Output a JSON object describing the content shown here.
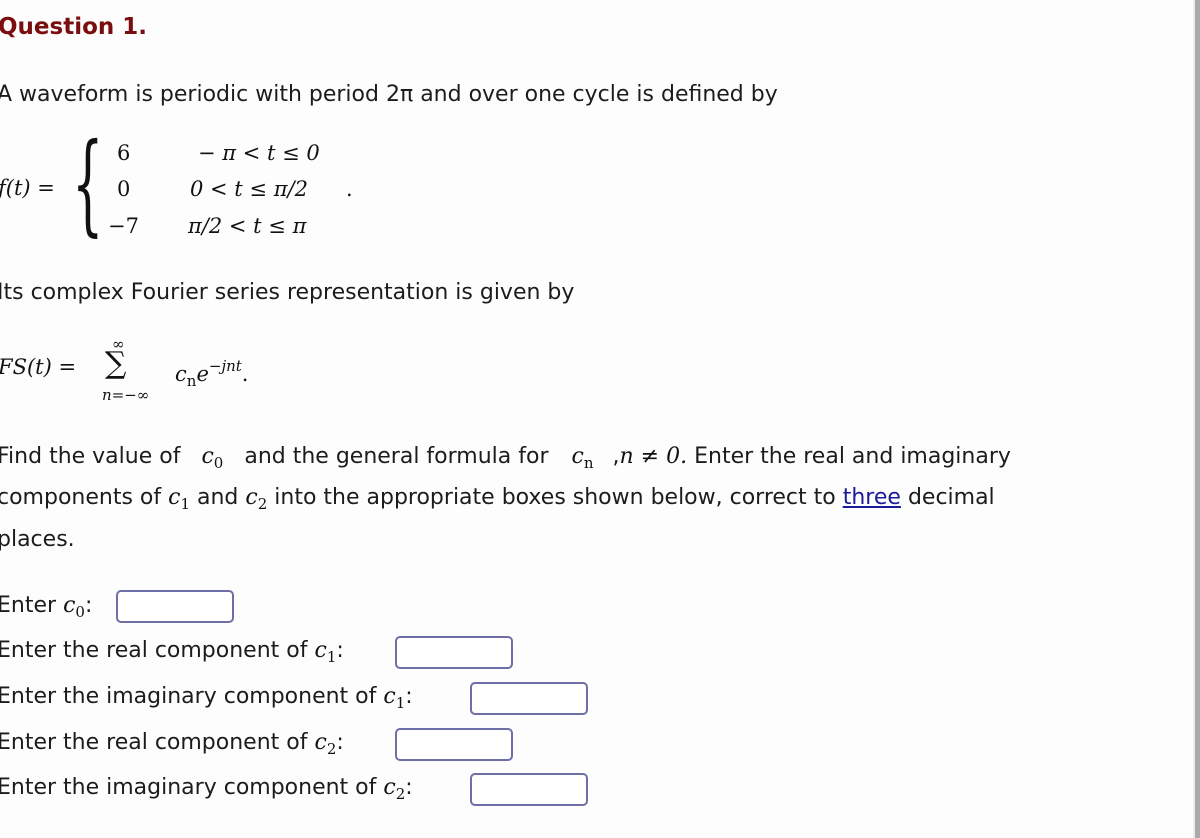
{
  "question": {
    "title": "Question 1.",
    "intro": "A waveform is periodic with period 2π and over one cycle is defined by",
    "function_lhs": "f(t) =",
    "piecewise": [
      {
        "value": "6",
        "condition": "− π < t ≤ 0"
      },
      {
        "value": "0",
        "condition": "0 < t ≤ π/2"
      },
      {
        "value": "−7",
        "condition": "π/2 < t ≤ π"
      }
    ],
    "piecewise_end": ".",
    "fourier_intro": "Its complex Fourier series representation is given by",
    "fourier": {
      "lhs": "FS(t) =",
      "sigma": "∑",
      "upper_limit": "∞",
      "lower_limit": "n=−∞",
      "term_base": "c",
      "term_sub": "n",
      "term_e": "e",
      "term_exp": "−jnt",
      "end": "."
    },
    "instructions": {
      "part1": "Find the value of",
      "c0_base": "c",
      "c0_sub": "0",
      "part2": "and the general formula for",
      "cn_base": "c",
      "cn_sub": "n",
      "part3": ",",
      "n_condition": "n ≠ 0.",
      "part4": "Enter the real and imaginary",
      "line2_a": "components of",
      "c1_base": "c",
      "c1_sub": "1",
      "line2_b": "and",
      "c2_base": "c",
      "c2_sub": "2",
      "line2_c": "into the appropriate boxes shown below, correct to",
      "link_text": "three",
      "line2_d": "decimal",
      "line3": "places."
    }
  },
  "answers": [
    {
      "label_pre": "Enter",
      "var": "c",
      "sub": "0",
      "label_post": ":",
      "value": "",
      "placeholder": ""
    },
    {
      "label_pre": "Enter the real component of",
      "var": "c",
      "sub": "1",
      "label_post": ":",
      "value": "",
      "placeholder": ""
    },
    {
      "label_pre": "Enter the imaginary component of",
      "var": "c",
      "sub": "1",
      "label_post": ":",
      "value": "",
      "placeholder": ""
    },
    {
      "label_pre": "Enter the real component of",
      "var": "c",
      "sub": "2",
      "label_post": ":",
      "value": "",
      "placeholder": ""
    },
    {
      "label_pre": "Enter the imaginary component of",
      "var": "c",
      "sub": "2",
      "label_post": ":",
      "value": "",
      "placeholder": ""
    }
  ],
  "colors": {
    "title": "#7a0d0d",
    "link": "#1a1a9a",
    "input_border": "#6f6fa8",
    "scrollbar": "#aaaaaa"
  }
}
